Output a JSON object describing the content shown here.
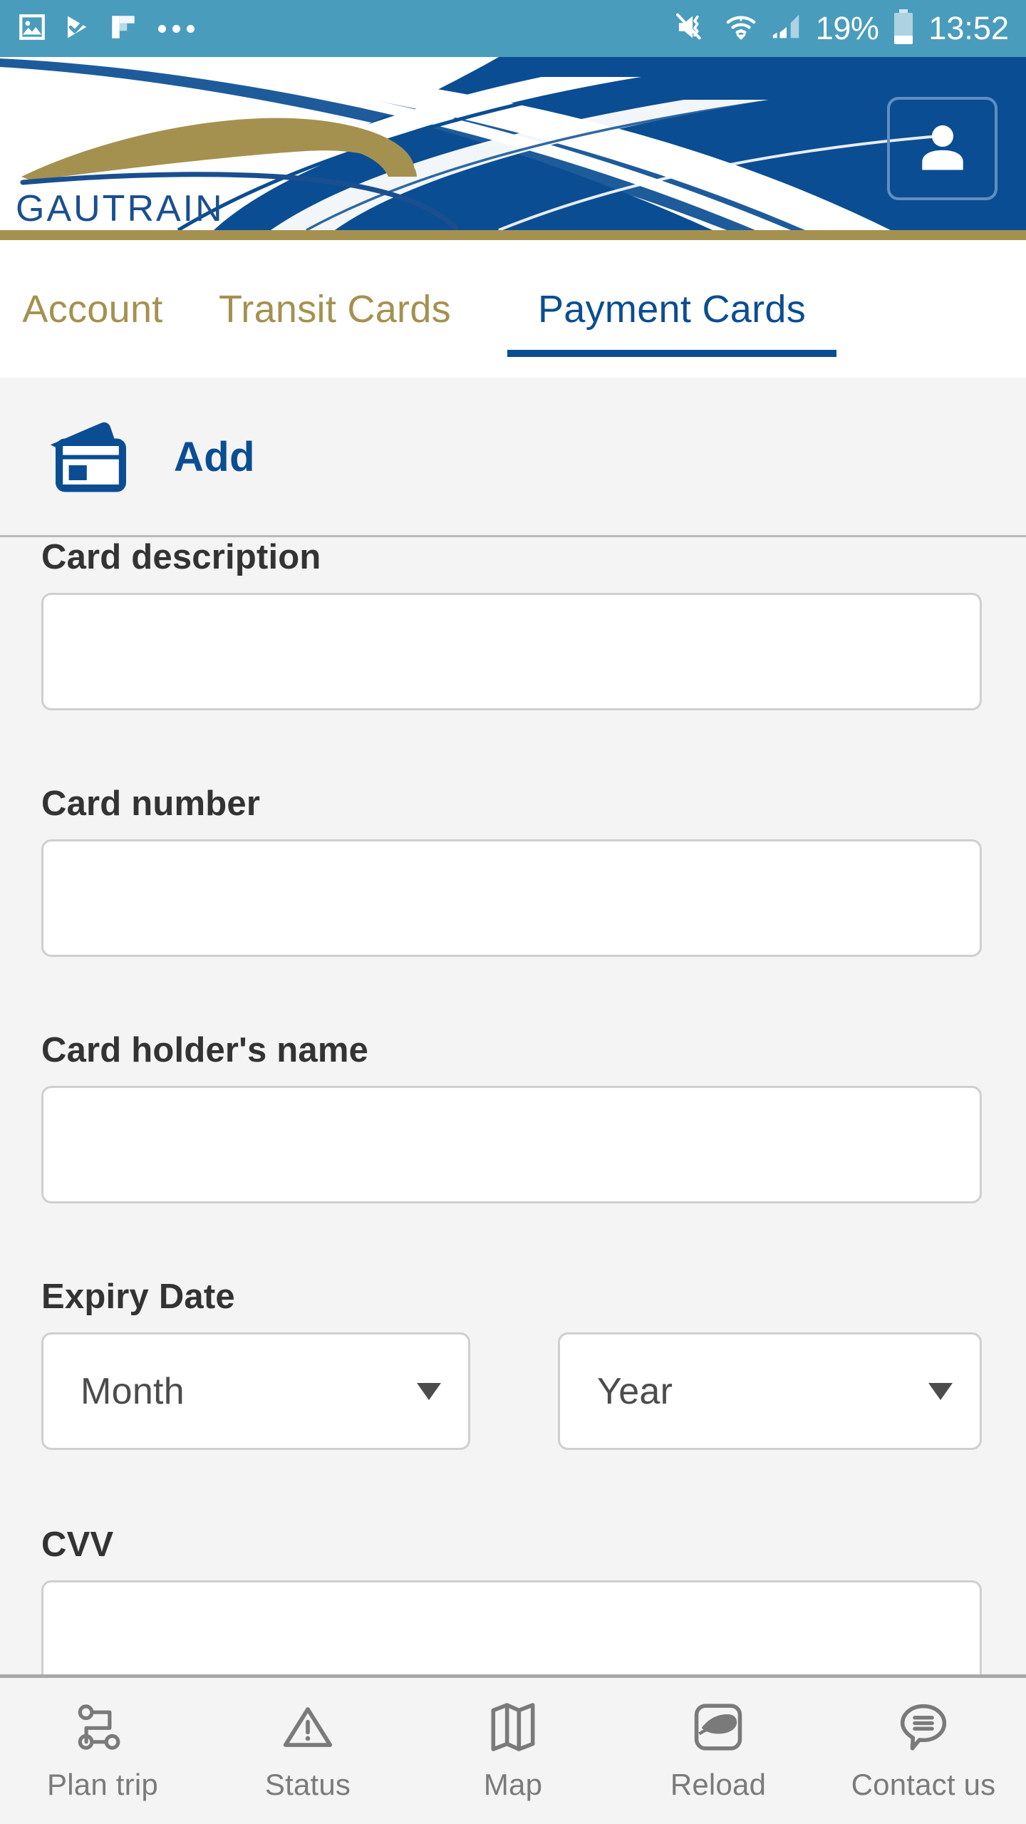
{
  "status_bar": {
    "left_icons": [
      "image-icon",
      "play-check-icon",
      "flipboard-icon",
      "more-dots-icon"
    ],
    "right_icons": [
      "mute-vibrate-icon",
      "wifi-icon",
      "cellular-signal-icon",
      "battery-icon"
    ],
    "battery_percent": "19%",
    "time": "13:52",
    "background_color": "#4a9cbd"
  },
  "header": {
    "brand_name": "GAUTRAIN",
    "profile_icon": "person-icon",
    "background_color": "#0b4d92",
    "gold_color": "#a5914f"
  },
  "tabs": {
    "items": [
      {
        "label": "Account",
        "active": false
      },
      {
        "label": "Transit Cards",
        "active": false
      },
      {
        "label": "Payment Cards",
        "active": true
      }
    ],
    "active_color": "#0b4d92",
    "inactive_color": "#a5914f"
  },
  "section": {
    "icon": "credit-cards-icon",
    "title": "Add"
  },
  "form": {
    "card_description": {
      "label": "Card description",
      "value": "",
      "placeholder": ""
    },
    "card_number": {
      "label": "Card number",
      "value": "",
      "placeholder": ""
    },
    "card_holder_name": {
      "label": "Card holder's name",
      "value": "",
      "placeholder": ""
    },
    "expiry_date": {
      "label": "Expiry Date",
      "month": {
        "selected": "Month"
      },
      "year": {
        "selected": "Year"
      }
    },
    "cvv": {
      "label": "CVV",
      "value": "",
      "placeholder": ""
    }
  },
  "bottom_nav": {
    "items": [
      {
        "label": "Plan trip",
        "icon": "route-icon"
      },
      {
        "label": "Status",
        "icon": "warning-triangle-icon"
      },
      {
        "label": "Map",
        "icon": "folded-map-icon"
      },
      {
        "label": "Reload",
        "icon": "gautrain-card-icon"
      },
      {
        "label": "Contact us",
        "icon": "speech-bubble-icon"
      }
    ],
    "text_color": "#7a7a7a"
  }
}
